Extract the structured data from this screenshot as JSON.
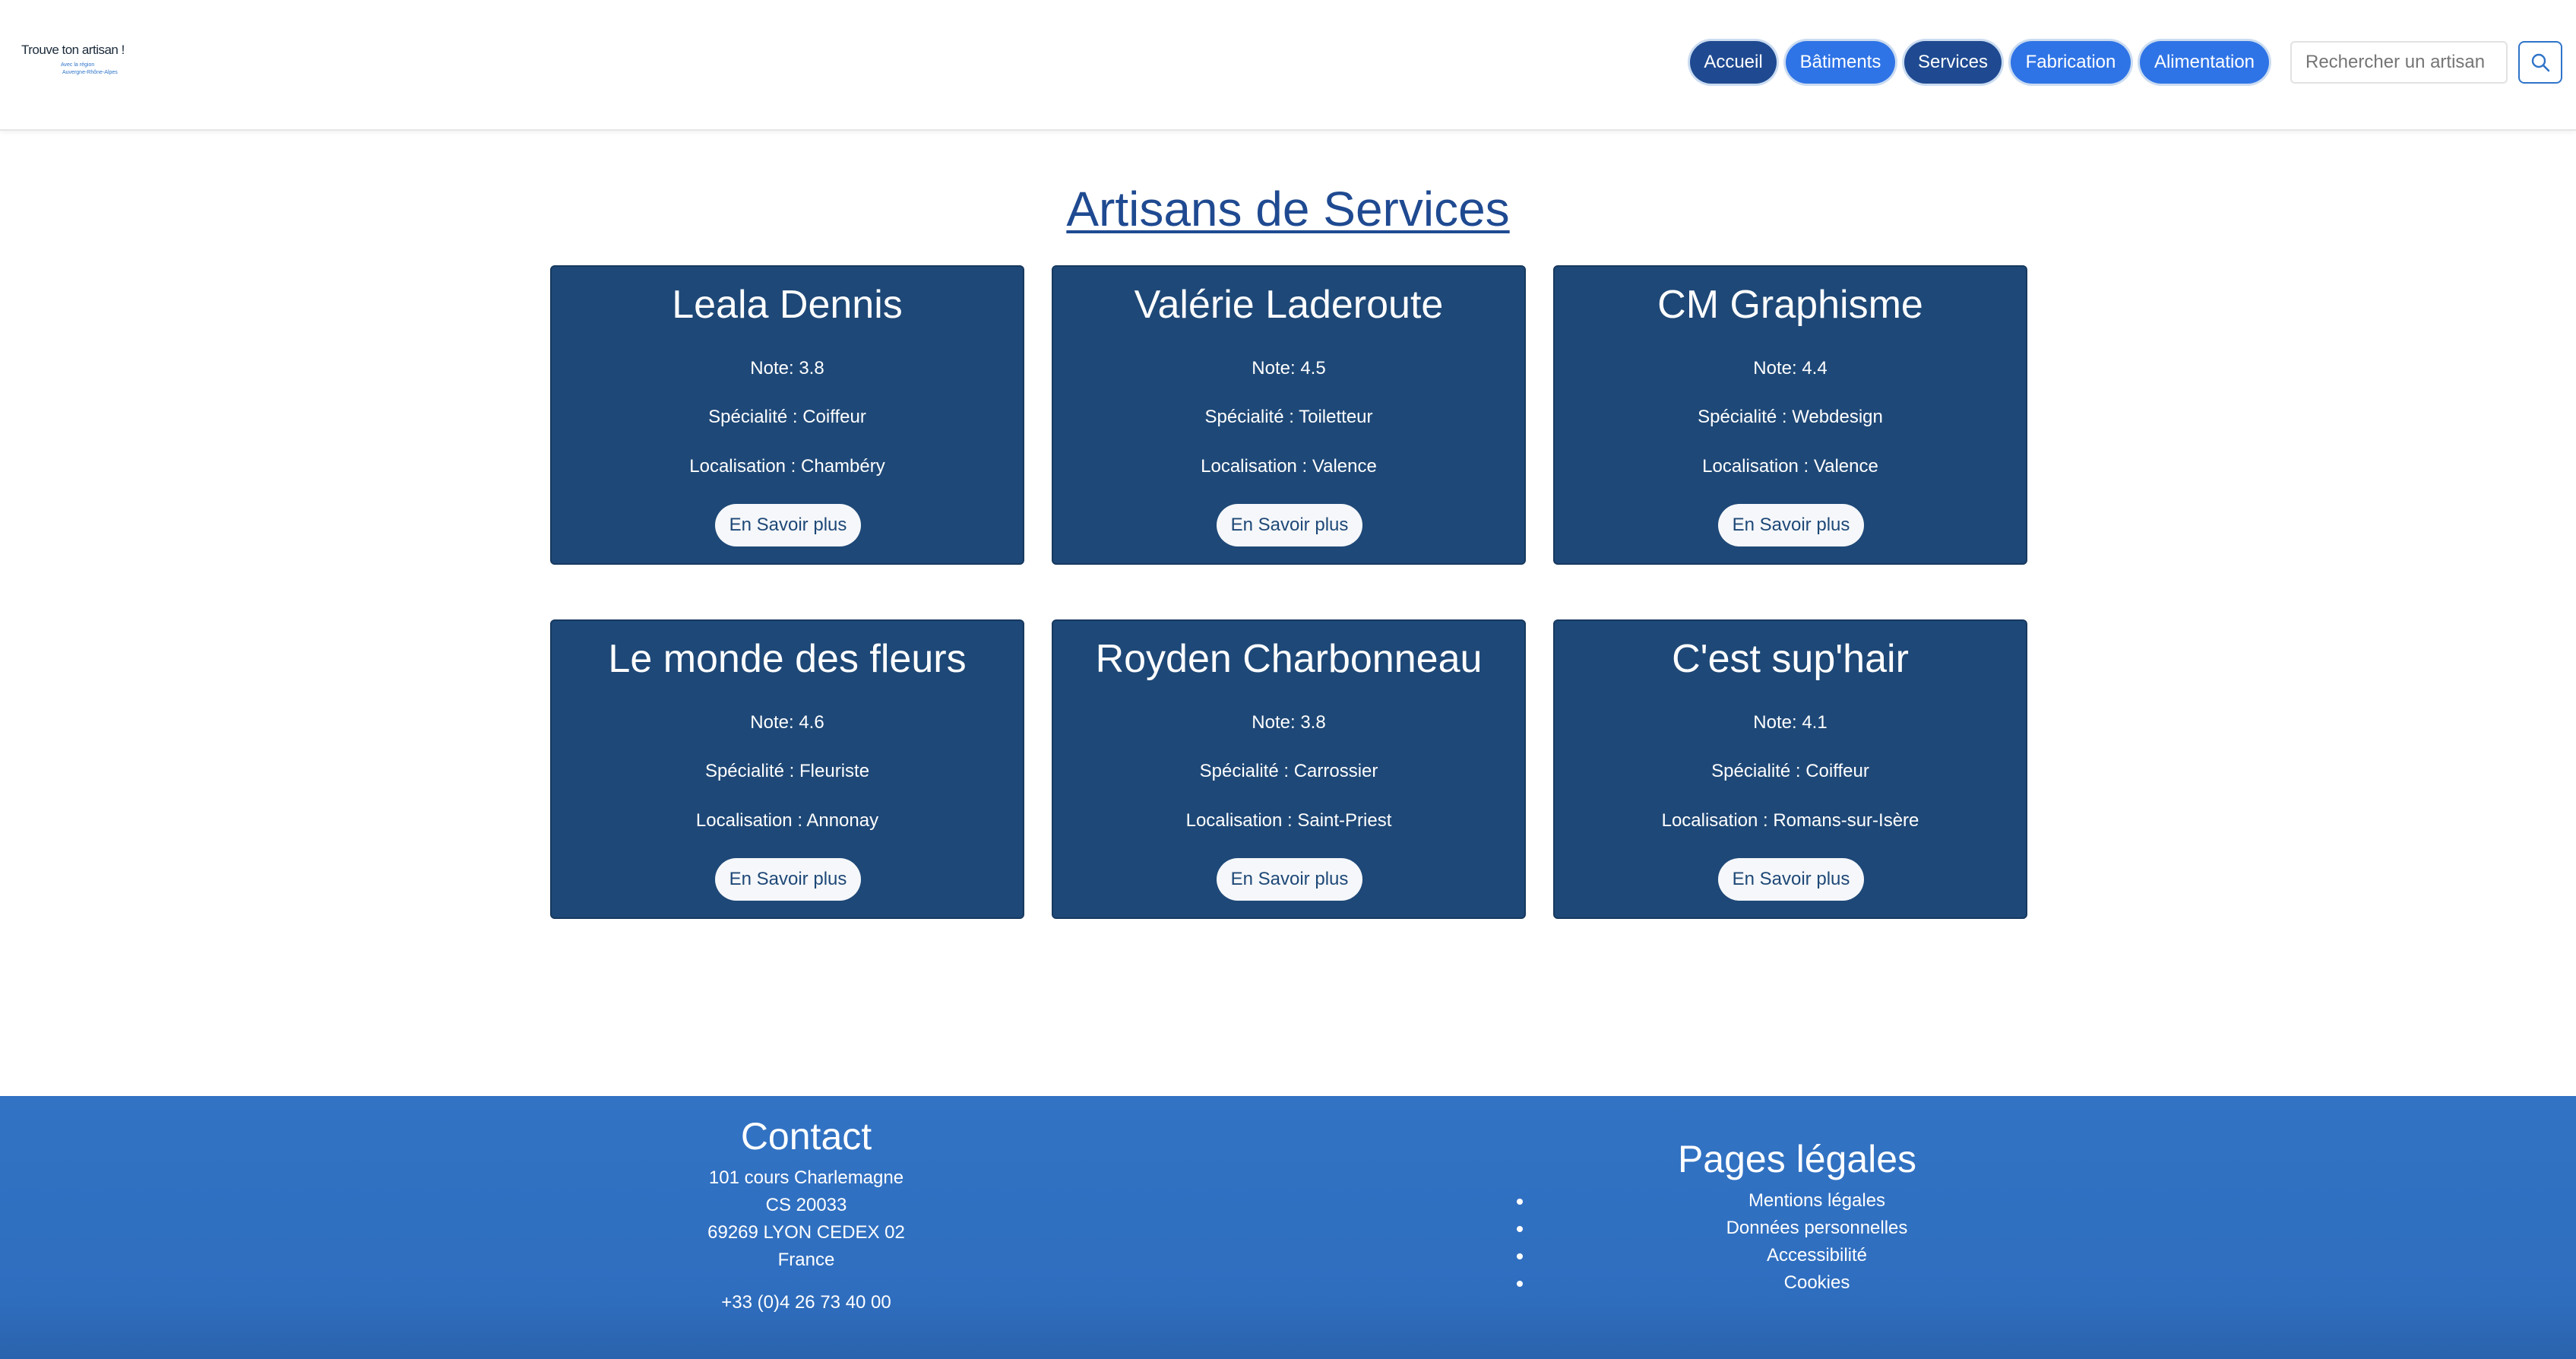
{
  "header": {
    "logo": {
      "title": "Trouve ton artisan !",
      "subtitle_line1": "Avec la région",
      "subtitle_line2": "Auvergne-Rhône-Alpes"
    },
    "nav": [
      {
        "label": "Accueil",
        "style": "dark"
      },
      {
        "label": "Bâtiments",
        "style": "light"
      },
      {
        "label": "Services",
        "style": "dark"
      },
      {
        "label": "Fabrication",
        "style": "light"
      },
      {
        "label": "Alimentation",
        "style": "light"
      }
    ],
    "search": {
      "placeholder": "Rechercher un artisan",
      "icon": "search-icon"
    }
  },
  "main": {
    "title": "Artisans de Services",
    "cards": [
      {
        "name": "Leala Dennis",
        "note": "Note: 3.8",
        "specialite": "Spécialité : Coiffeur",
        "localisation": "Localisation : Chambéry",
        "button": "En Savoir plus"
      },
      {
        "name": "Valérie Laderoute",
        "note": "Note: 4.5",
        "specialite": "Spécialité : Toiletteur",
        "localisation": "Localisation : Valence",
        "button": "En Savoir plus"
      },
      {
        "name": "CM Graphisme",
        "note": "Note: 4.4",
        "specialite": "Spécialité : Webdesign",
        "localisation": "Localisation : Valence",
        "button": "En Savoir plus"
      },
      {
        "name": "Le monde des fleurs",
        "note": "Note: 4.6",
        "specialite": "Spécialité : Fleuriste",
        "localisation": "Localisation : Annonay",
        "button": "En Savoir plus"
      },
      {
        "name": "Royden Charbonneau",
        "note": "Note: 3.8",
        "specialite": "Spécialité : Carrossier",
        "localisation": "Localisation : Saint-Priest",
        "button": "En Savoir plus"
      },
      {
        "name": "C'est sup'hair",
        "note": "Note: 4.1",
        "specialite": "Spécialité : Coiffeur",
        "localisation": "Localisation : Romans-sur-Isère",
        "button": "En Savoir plus"
      }
    ]
  },
  "footer": {
    "contact": {
      "title": "Contact",
      "address_lines": [
        "101 cours Charlemagne",
        "CS 20033",
        "69269 LYON CEDEX 02",
        "France"
      ],
      "phone": "+33 (0)4 26 73 40 00"
    },
    "legal": {
      "title": "Pages légales",
      "links": [
        "Mentions légales",
        "Données personnelles",
        "Accessibilité",
        "Cookies"
      ]
    }
  },
  "colors": {
    "nav_dark": "#1f4a91",
    "nav_light": "#2f74e6",
    "card_bg": "#1e4877",
    "footer_bg": "#3273c4",
    "title": "#1f4a91"
  }
}
